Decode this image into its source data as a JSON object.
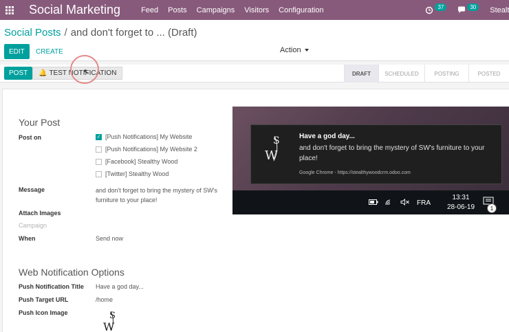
{
  "navbar": {
    "brand": "Social Marketing",
    "menu": [
      "Feed",
      "Posts",
      "Campaigns",
      "Visitors",
      "Configuration"
    ],
    "activity_count": "37",
    "messages_count": "30",
    "user": "Stealthy"
  },
  "breadcrumb": {
    "parent": "Social Posts",
    "separator": "/",
    "current": "and don't forget to ... (Draft)"
  },
  "control": {
    "edit_label": "EDIT",
    "create_label": "CREATE",
    "action_label": "Action"
  },
  "statusbar": {
    "post_label": "POST",
    "test_label": "TEST NOTIFICATION",
    "stages": [
      "DRAFT",
      "SCHEDULED",
      "POSTING",
      "POSTED"
    ],
    "active_stage": "DRAFT"
  },
  "form": {
    "your_post_title": "Your Post",
    "post_on_label": "Post on",
    "accounts": [
      {
        "label": "[Push Notifications] My Website",
        "checked": true
      },
      {
        "label": "[Push Notifications] My Website 2",
        "checked": false
      },
      {
        "label": "[Facebook] Stealthy Wood",
        "checked": false
      },
      {
        "label": "[Twitter] Stealthy Wood",
        "checked": false
      }
    ],
    "message_label": "Message",
    "message_value": "and don't forget to bring the mystery of SW's furniture to your place!",
    "attach_images_label": "Attach Images",
    "campaign_label": "Campaign",
    "when_label": "When",
    "when_value": "Send now",
    "web_options_title": "Web Notification Options",
    "push_title_label": "Push Notification Title",
    "push_title_value": "Have a god day...",
    "push_url_label": "Push Target URL",
    "push_url_value": "/home",
    "push_icon_label": "Push Icon Image"
  },
  "notification_preview": {
    "title": "Have a god day...",
    "body": "and don't forget to bring the mystery of SW's furniture to your place!",
    "source": "Google Chrome - https://stealthywoodcrm.odoo.com",
    "taskbar_lang": "FRA",
    "taskbar_time": "13:31",
    "taskbar_date": "28-06-19",
    "taskbar_notif_count": "1"
  },
  "colors": {
    "navbar": "#875a7b",
    "primary": "#00a09d"
  }
}
